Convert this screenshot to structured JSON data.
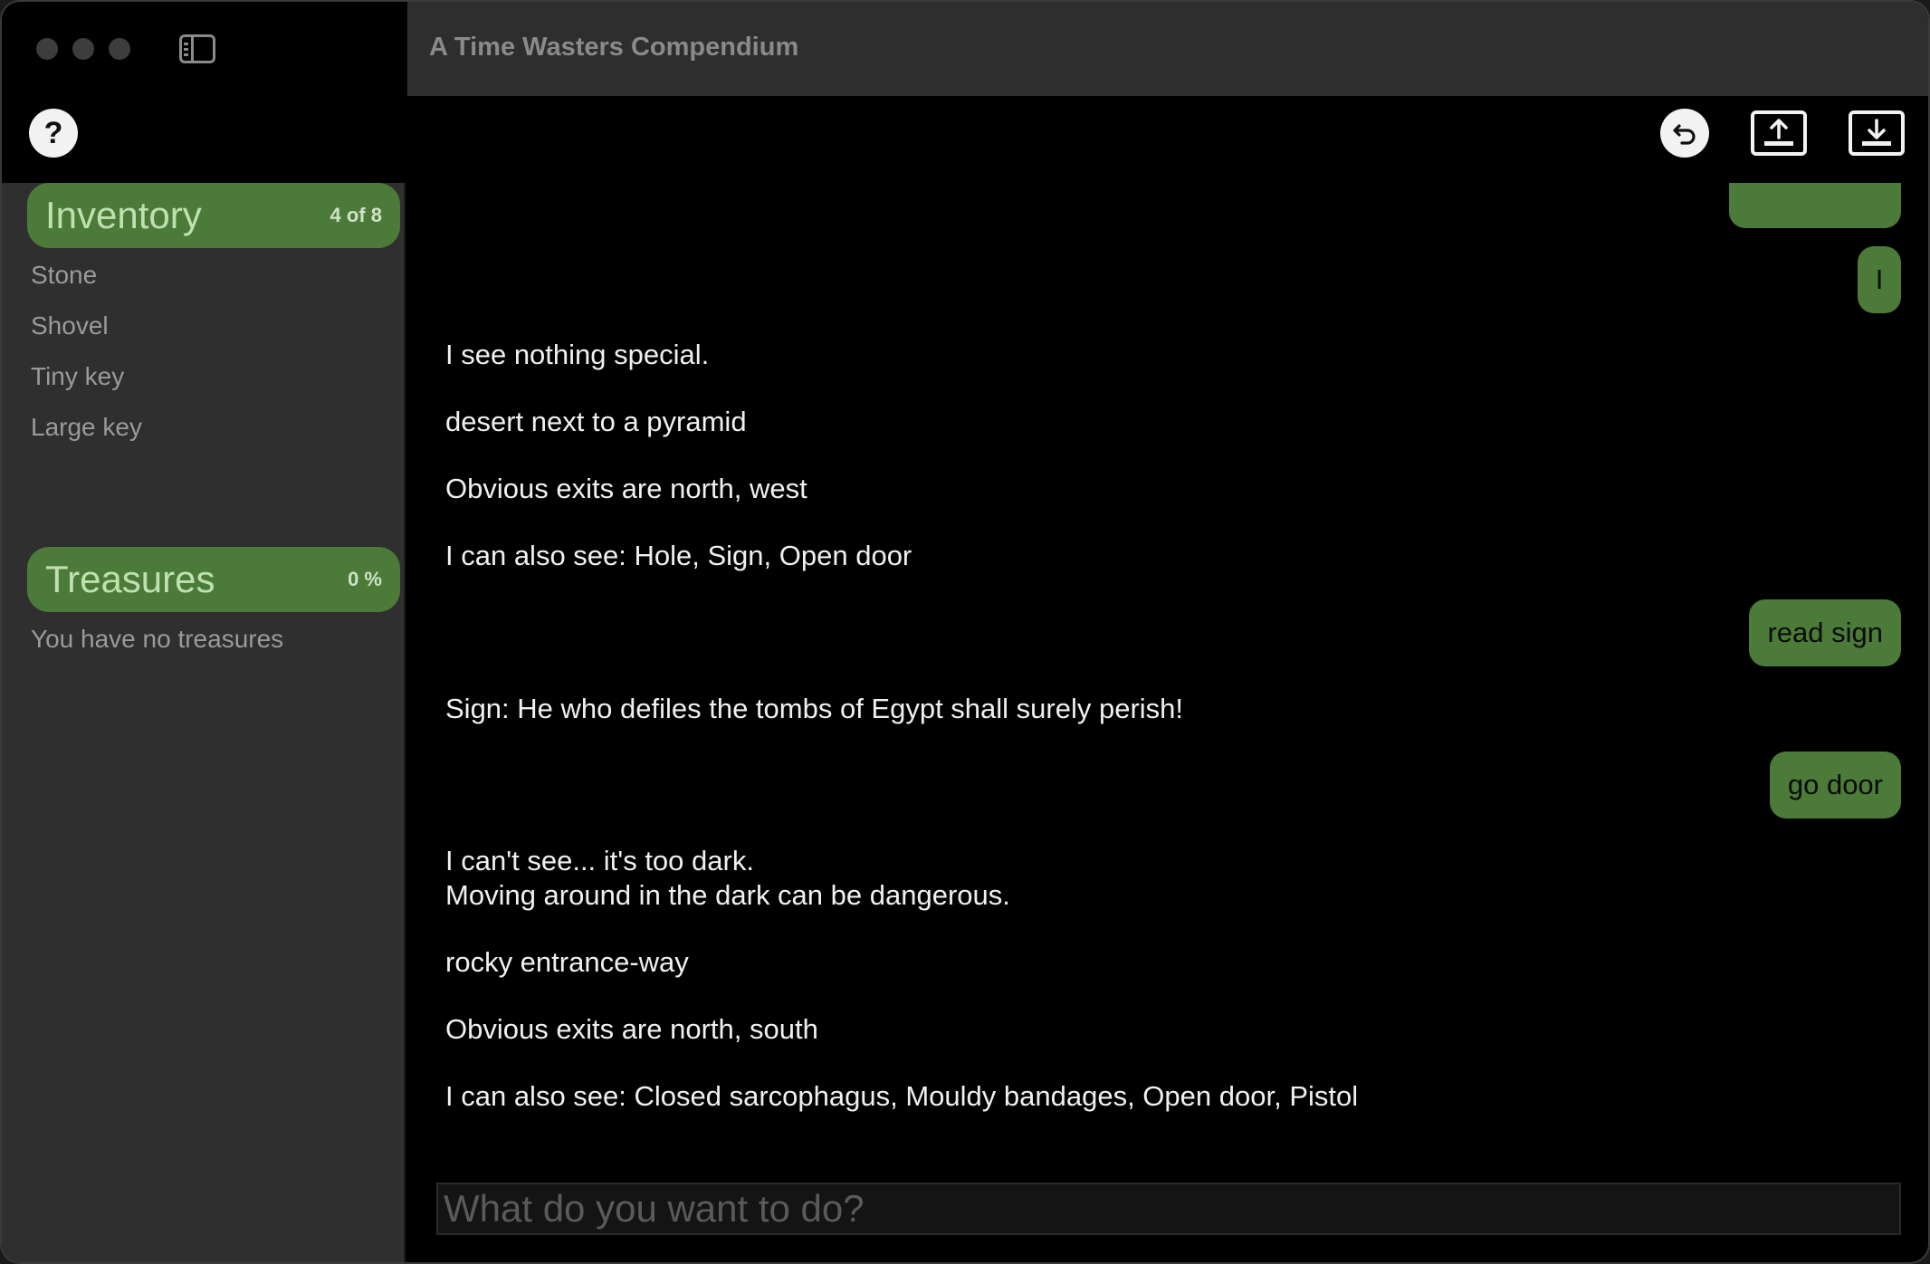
{
  "window": {
    "title": "A Time Wasters Compendium"
  },
  "sidebar": {
    "help_label": "?",
    "inventory": {
      "title": "Inventory",
      "count": "4 of 8",
      "items": [
        "Stone",
        "Shovel",
        "Tiny key",
        "Large key"
      ]
    },
    "treasures": {
      "title": "Treasures",
      "count": "0 %",
      "empty_text": "You have no treasures"
    }
  },
  "transcript": {
    "commands": [
      "I",
      "read sign",
      "go door"
    ],
    "outputs": [
      "I see nothing special.",
      "desert next to a pyramid",
      "Obvious exits are north, west",
      "I can also see: Hole, Sign, Open door",
      "Sign: He who defiles the tombs of Egypt shall surely perish!",
      "I can't see... it's too dark.\nMoving around in the dark can be dangerous.",
      "rocky entrance-way",
      "Obvious exits are north, south",
      "I can also see: Closed sarcophagus, Mouldy bandages, Open door, Pistol"
    ]
  },
  "input": {
    "placeholder": "What do you want to do?"
  },
  "colors": {
    "accent": "#4c7a38",
    "accent_text": "#bfe0b0"
  },
  "icons": {
    "undo": "undo-icon",
    "export": "upload-tray-icon",
    "import": "download-tray-icon",
    "sidebar_toggle": "sidebar-icon"
  }
}
